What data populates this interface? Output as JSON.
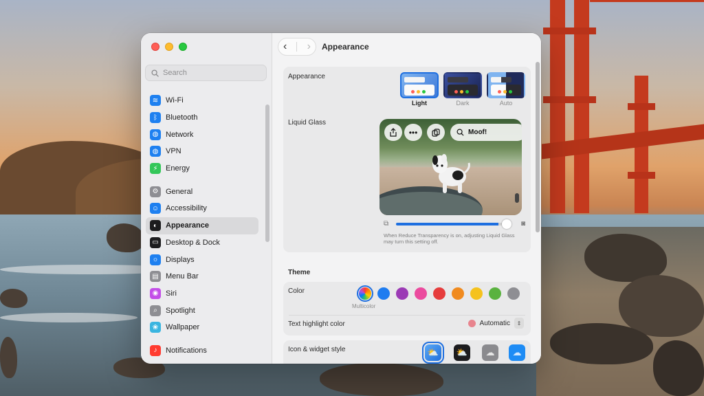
{
  "window": {
    "search": {
      "placeholder": "Search"
    },
    "sidebar": {
      "items": [
        {
          "label": "Wi-Fi",
          "icon": "wifi-icon",
          "color": "#1e80f0",
          "glyph": "≋"
        },
        {
          "label": "Bluetooth",
          "icon": "bluetooth-icon",
          "color": "#1e80f0",
          "glyph": "ᛒ"
        },
        {
          "label": "Network",
          "icon": "globe-icon",
          "color": "#1e80f0",
          "glyph": "◍"
        },
        {
          "label": "VPN",
          "icon": "vpn-globe-icon",
          "color": "#1e80f0",
          "glyph": "◍"
        },
        {
          "label": "Energy",
          "icon": "bolt-icon",
          "color": "#34c759",
          "glyph": "⚡"
        },
        {
          "label": "General",
          "icon": "gear-icon",
          "color": "#8e8e93",
          "glyph": "⚙"
        },
        {
          "label": "Accessibility",
          "icon": "accessibility-icon",
          "color": "#1e80f0",
          "glyph": "☺"
        },
        {
          "label": "Appearance",
          "icon": "appearance-icon",
          "color": "#1c1c1e",
          "glyph": "◐"
        },
        {
          "label": "Desktop & Dock",
          "icon": "dock-icon",
          "color": "#1c1c1e",
          "glyph": "▭"
        },
        {
          "label": "Displays",
          "icon": "sun-icon",
          "color": "#1e80f0",
          "glyph": "☼"
        },
        {
          "label": "Menu Bar",
          "icon": "menubar-icon",
          "color": "#8e8e93",
          "glyph": "▤"
        },
        {
          "label": "Siri",
          "icon": "siri-icon",
          "color": "#c34ee8",
          "glyph": "◉"
        },
        {
          "label": "Spotlight",
          "icon": "magnifier-icon",
          "color": "#8e8e93",
          "glyph": "⌕"
        },
        {
          "label": "Wallpaper",
          "icon": "flower-icon",
          "color": "#3ab5e0",
          "glyph": "❀"
        },
        {
          "label": "Notifications",
          "icon": "bell-icon",
          "color": "#ff3b30",
          "glyph": "♪"
        }
      ],
      "active_index": 7
    },
    "toolbar": {
      "back": "‹",
      "forward": "›",
      "title": "Appearance"
    },
    "appearance": {
      "label": "Appearance",
      "options": [
        {
          "caption": "Light",
          "selected": true
        },
        {
          "caption": "Dark",
          "selected": false
        },
        {
          "caption": "Auto",
          "selected": false
        }
      ]
    },
    "liquid_glass": {
      "label": "Liquid Glass",
      "address_text": "Moof!",
      "slider_value": 0.93,
      "note": "When Reduce Transparency is on, adjusting Liquid Glass may turn this setting off."
    },
    "theme": {
      "section_title": "Theme",
      "color_label": "Color",
      "colors": [
        "multicolor",
        "#1e7cf0",
        "#9b3ab5",
        "#eb4a9e",
        "#e63c3c",
        "#f08a1e",
        "#f5c21c",
        "#5ab23f",
        "#8e8e93"
      ],
      "selected_color_caption": "Multicolor",
      "highlight_label": "Text highlight color",
      "highlight_value": "Automatic"
    },
    "icon_style": {
      "label": "Icon & widget style"
    }
  }
}
